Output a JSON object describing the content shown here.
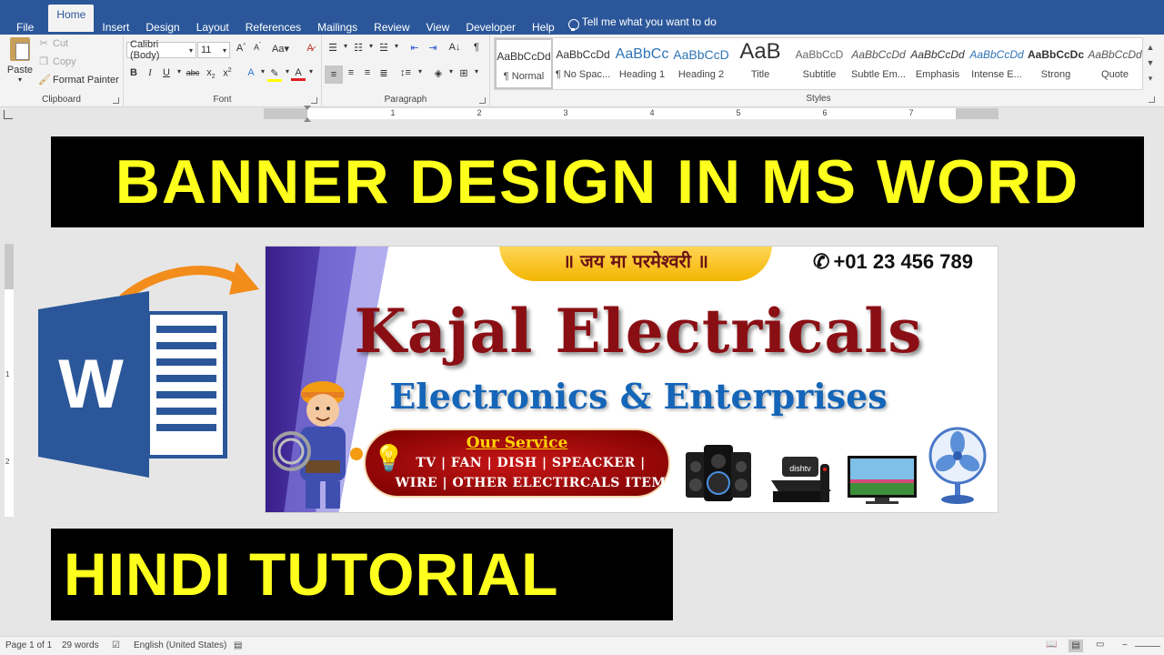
{
  "menubar": {
    "tabs": [
      "File",
      "Home",
      "Insert",
      "Design",
      "Layout",
      "References",
      "Mailings",
      "Review",
      "View",
      "Developer",
      "Help"
    ],
    "active_tab": "Home",
    "tell_me": "Tell me what you want to do"
  },
  "clipboard": {
    "paste": "Paste",
    "cut": "Cut",
    "copy": "Copy",
    "format_painter": "Format Painter",
    "label": "Clipboard"
  },
  "font": {
    "name": "Calibri (Body)",
    "size": "11",
    "label": "Font"
  },
  "paragraph": {
    "label": "Paragraph"
  },
  "styles": {
    "label": "Styles",
    "items": [
      {
        "preview": "AaBbCcDd",
        "name": "¶ Normal"
      },
      {
        "preview": "AaBbCcDd",
        "name": "¶ No Spac..."
      },
      {
        "preview": "AaBbCc",
        "name": "Heading 1"
      },
      {
        "preview": "AaBbCcD",
        "name": "Heading 2"
      },
      {
        "preview": "AaB",
        "name": "Title"
      },
      {
        "preview": "AaBbCcD",
        "name": "Subtitle"
      },
      {
        "preview": "AaBbCcDd",
        "name": "Subtle Em..."
      },
      {
        "preview": "AaBbCcDd",
        "name": "Emphasis"
      },
      {
        "preview": "AaBbCcDd",
        "name": "Intense E..."
      },
      {
        "preview": "AaBbCcDc",
        "name": "Strong"
      },
      {
        "preview": "AaBbCcDd",
        "name": "Quote"
      }
    ]
  },
  "ruler": {
    "numbers": [
      "1",
      "2",
      "3",
      "4",
      "5",
      "6",
      "7"
    ],
    "vnumbers": [
      "1",
      "2"
    ]
  },
  "thumbnail": {
    "title": "BANNER DESIGN IN MS WORD",
    "subtitle": "HINDI TUTORIAL",
    "word_letter": "W",
    "colors": {
      "text": "#ffff1e",
      "background": "#000000"
    }
  },
  "banner": {
    "blessing": "॥ जय मा परमेश्वरी ॥",
    "phone": "+01 23 456 789",
    "brand": "Kajal Electricals",
    "tagline": "Electronics & Enterprises",
    "service_title": "Our Service",
    "service_line1": "TV | FAN | DISH | SPEACKER |",
    "service_line2": "WIRE | OTHER ELECTIRCALS ITEM",
    "dish_brand": "dishtv"
  },
  "statusbar": {
    "page": "Page 1 of 1",
    "words": "29 words",
    "language": "English (United States)"
  }
}
